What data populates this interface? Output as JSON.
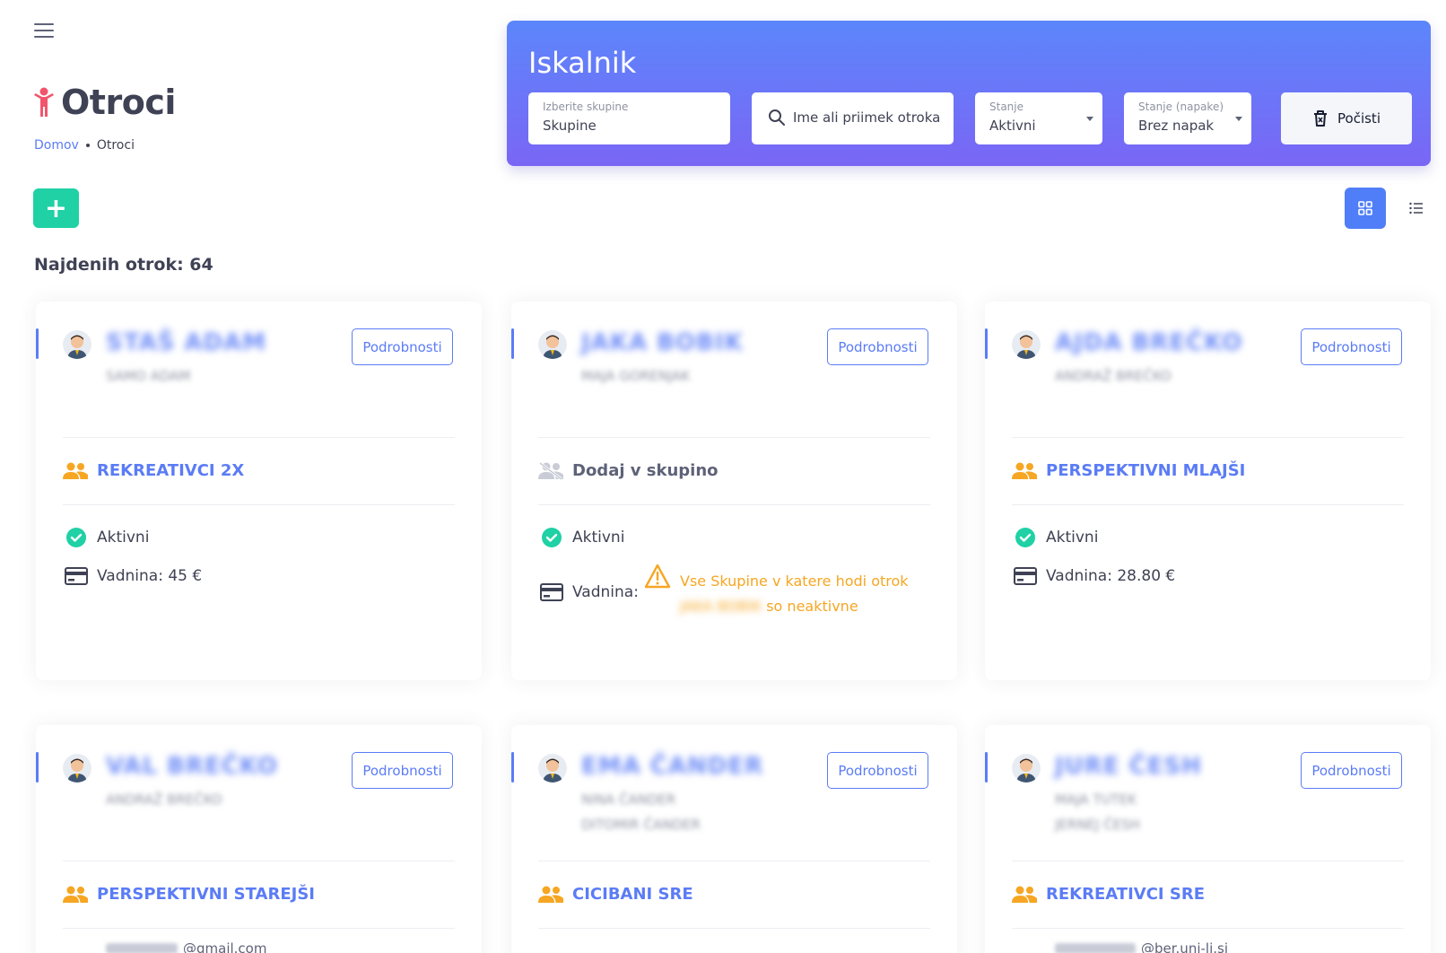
{
  "header": {
    "title": "Otroci",
    "breadcrumb": {
      "home": "Domov",
      "current": "Otroci"
    },
    "add_label": "+",
    "found_count": "Najdenih otrok: 64"
  },
  "search": {
    "title": "Iskalnik",
    "group_field": {
      "label": "Izberite skupine",
      "value": "Skupine"
    },
    "name_field": {
      "placeholder": "Ime ali priimek otroka"
    },
    "status_field": {
      "label": "Stanje",
      "value": "Aktivni"
    },
    "error_field": {
      "label": "Stanje (napake)",
      "value": "Brez napak"
    },
    "clear_label": "Počisti"
  },
  "cards": [
    {
      "child_name": "STAŠ ADAM",
      "parents": [
        "SAMO ADAM"
      ],
      "details_label": "Podrobnosti",
      "group": "REKREATIVCI 2X",
      "status": "Aktivni",
      "fee": "Vadnina: 45 €"
    },
    {
      "child_name": "JAKA BOBIK",
      "parents": [
        "MAJA GORENJAK"
      ],
      "details_label": "Podrobnosti",
      "group": "Dodaj v skupino",
      "status": "Aktivni",
      "fee": "Vadnina:",
      "warning_pre": "Vse Skupine v katere hodi otrok",
      "warning_name1": "JAKA",
      "warning_name2": "BOBIK",
      "warning_post": "so neaktivne"
    },
    {
      "child_name": "AJDA BREČKO",
      "parents": [
        "ANDRAŽ BREČKO"
      ],
      "details_label": "Podrobnosti",
      "group": "PERSPEKTIVNI MLAJŠI",
      "status": "Aktivni",
      "fee": "Vadnina: 28.80 €"
    },
    {
      "child_name": "VAL BREČKO",
      "parents": [
        "ANDRAŽ BREČKO"
      ],
      "details_label": "Podrobnosti",
      "group": "PERSPEKTIVNI STAREJŠI",
      "contact": "@gmail.com"
    },
    {
      "child_name": "EMA ČANDER",
      "parents": [
        "NINA ČANDER",
        "DITOMIR ČANDER"
      ],
      "details_label": "Podrobnosti",
      "group": "CICIBANI SRE"
    },
    {
      "child_name": "JURE ČESH",
      "parents": [
        "MAJA TUTEK",
        "JERNEJ ČESH"
      ],
      "details_label": "Podrobnosti",
      "group": "REKREATIVCI SRE",
      "contact": "@ber.uni-lj.si"
    }
  ],
  "colors": {
    "accent": "#5b7cf6",
    "success": "#1fd1a5",
    "warning": "#f6a623",
    "group_icon": "#f6a623"
  }
}
